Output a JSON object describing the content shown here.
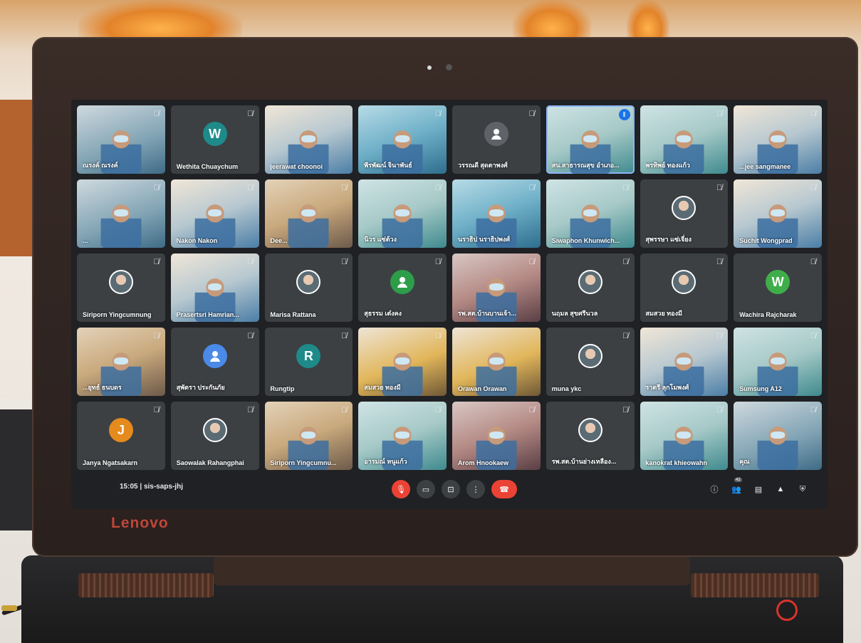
{
  "meeting": {
    "time": "15:05",
    "separator": "|",
    "code": "sis-saps-jhj",
    "participant_count": "42"
  },
  "brand": "Lenovo",
  "colors": {
    "screen_bg": "#202124",
    "tile_bg": "#3c4043",
    "danger": "#ea4335",
    "active_border": "#8ab4f8"
  },
  "tiles": [
    {
      "name": "ณรงค์ ณรงค์",
      "kind": "video",
      "style": "v1",
      "mic": "off"
    },
    {
      "name": "Wethita Chuaychum",
      "kind": "letter",
      "letter": "W",
      "color": "#1e8a8a",
      "mic": "off"
    },
    {
      "name": "jeerawat choonoi",
      "kind": "video",
      "style": "v2",
      "mic": ""
    },
    {
      "name": "พีรพัฒน์ จินาพันธ์",
      "kind": "video",
      "style": "v4",
      "mic": "off"
    },
    {
      "name": "วรรณดี สุดตาพงศ์",
      "kind": "person-icon",
      "color": "#5f6368",
      "mic": "off"
    },
    {
      "name": "สน.สาธารณสุข อำเภอ...",
      "kind": "video",
      "style": "v6",
      "mic": "speaking",
      "active": true
    },
    {
      "name": "พรทิพย์ ทองแก้ว",
      "kind": "video",
      "style": "v6",
      "mic": "off"
    },
    {
      "name": "...jee sangmanee",
      "kind": "video",
      "style": "v2",
      "mic": "off"
    },
    {
      "name": "...",
      "kind": "video",
      "style": "v1",
      "mic": "off"
    },
    {
      "name": "Nakon Nakon",
      "kind": "video",
      "style": "v2",
      "mic": "off"
    },
    {
      "name": "Dee...",
      "kind": "video",
      "style": "v3",
      "mic": "off"
    },
    {
      "name": "นิวร แซ่ต้วง",
      "kind": "video",
      "style": "v6",
      "mic": "off"
    },
    {
      "name": "นราธิป นราธิปพงศ์",
      "kind": "video",
      "style": "v4",
      "mic": "off"
    },
    {
      "name": "Siwaphon Khunwich...",
      "kind": "video",
      "style": "v6",
      "mic": "off"
    },
    {
      "name": "สุพรรษา แซ่เจี่ยง",
      "kind": "photo",
      "mic": "off"
    },
    {
      "name": "Suchit Wongprad",
      "kind": "video",
      "style": "v2",
      "mic": "off"
    },
    {
      "name": "Siriporn Yingcumnung",
      "kind": "photo",
      "mic": "off"
    },
    {
      "name": "Prasertsri Hamrian...",
      "kind": "video",
      "style": "v2",
      "mic": "off"
    },
    {
      "name": "Marisa Rattana",
      "kind": "photo",
      "mic": "off"
    },
    {
      "name": "สุธรรม เต๋งคง",
      "kind": "person-icon",
      "color": "#2e9d4a",
      "mic": "off"
    },
    {
      "name": "รพ.สต.บ้านบานเจ้า...",
      "kind": "video",
      "style": "v7",
      "mic": "off"
    },
    {
      "name": "นฤมล สุขศรีนวล",
      "kind": "photo",
      "mic": "off"
    },
    {
      "name": "สมสวย ทองมี",
      "kind": "photo",
      "mic": "off"
    },
    {
      "name": "Wachira Rajcharak",
      "kind": "letter",
      "letter": "W",
      "color": "#3fae4a",
      "mic": "off"
    },
    {
      "name": "...ยุทธ์ ธนบดร",
      "kind": "video",
      "style": "v3",
      "mic": "off"
    },
    {
      "name": "สุพัตรา ประกันภัย",
      "kind": "person-icon",
      "color": "#4a8ae8",
      "mic": "off"
    },
    {
      "name": "Rungtip",
      "kind": "letter",
      "letter": "R",
      "color": "#1e8a8a",
      "mic": "off"
    },
    {
      "name": "สมสวย ทองมี",
      "kind": "video",
      "style": "v5",
      "mic": "off"
    },
    {
      "name": "Orawan Orawan",
      "kind": "video",
      "style": "v5",
      "mic": ""
    },
    {
      "name": "muna ykc",
      "kind": "photo",
      "mic": "off"
    },
    {
      "name": "ราตรี ลุกโมพงศ์",
      "kind": "video",
      "style": "v2",
      "mic": "off"
    },
    {
      "name": "Sumsung A12",
      "kind": "video",
      "style": "v6",
      "mic": "off"
    },
    {
      "name": "Janya Ngatsakarn",
      "kind": "letter",
      "letter": "J",
      "color": "#e58a1c",
      "mic": "off"
    },
    {
      "name": "Saowalak Rahangphai",
      "kind": "photo",
      "mic": "off"
    },
    {
      "name": "Siriporn Yingcumnu...",
      "kind": "video",
      "style": "v3",
      "mic": "off"
    },
    {
      "name": "อารมณ์ หนูแก้ว",
      "kind": "video",
      "style": "v6",
      "mic": "off"
    },
    {
      "name": "Arom Hnookaew",
      "kind": "video",
      "style": "v7",
      "mic": "off"
    },
    {
      "name": "รพ.สต.บ้านย่างเหลือง...",
      "kind": "photo",
      "mic": "off"
    },
    {
      "name": "kanokrat khieowahn",
      "kind": "video",
      "style": "v6",
      "mic": "off"
    },
    {
      "name": "คุณ",
      "kind": "video",
      "style": "v1",
      "mic": "off"
    }
  ],
  "controls": [
    {
      "name": "mic-toggle-button",
      "icon": "mic-off-icon",
      "glyph": "🎙",
      "style": "red"
    },
    {
      "name": "camera-toggle-button",
      "icon": "camera-icon",
      "glyph": "▭",
      "style": ""
    },
    {
      "name": "present-button",
      "icon": "present-icon",
      "glyph": "⊡",
      "style": ""
    },
    {
      "name": "more-options-button",
      "icon": "more-vert-icon",
      "glyph": "⋮",
      "style": ""
    },
    {
      "name": "leave-call-button",
      "icon": "hang-up-icon",
      "glyph": "☎",
      "style": "hang"
    }
  ],
  "right_icons": [
    {
      "name": "info-button",
      "icon": "info-icon",
      "glyph": "ⓘ"
    },
    {
      "name": "people-button",
      "icon": "people-icon",
      "glyph": "👥",
      "badge": true
    },
    {
      "name": "chat-button",
      "icon": "chat-icon",
      "glyph": "▤"
    },
    {
      "name": "activities-button",
      "icon": "activities-icon",
      "glyph": "▲"
    },
    {
      "name": "host-controls-button",
      "icon": "shield-icon",
      "glyph": "⛨"
    }
  ]
}
